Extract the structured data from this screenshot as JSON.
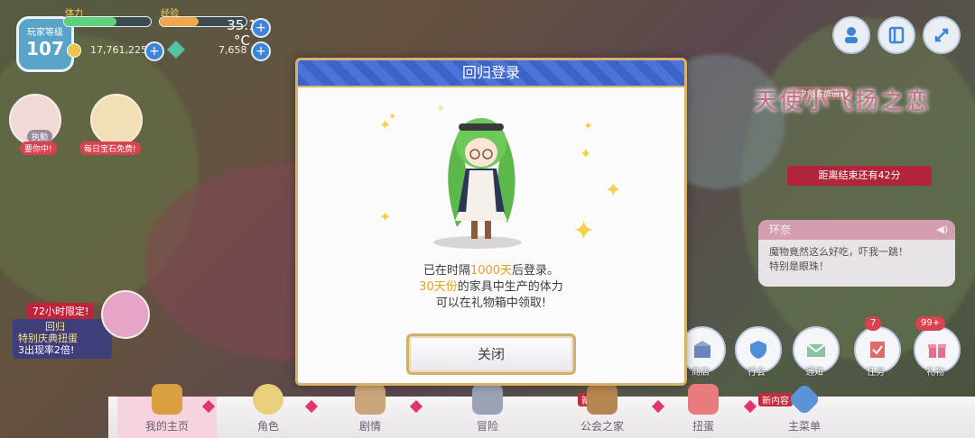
{
  "player": {
    "level_label": "玩家等级",
    "level": "107",
    "stamina_label": "体力",
    "exp_label": "经验",
    "stamina_fill": 0.6,
    "exp_fill": 0.45,
    "temperature": "35.1 °C",
    "mana": "17,761,225",
    "jewels": "7,658"
  },
  "top_buttons": [
    "person-icon",
    "window-icon",
    "resize-icon"
  ],
  "left_chars": [
    {
      "tag": "执勤"
    },
    {
      "tag": "要你中!"
    },
    {
      "tag": "每日宝石免费!"
    }
  ],
  "event": {
    "subtitle": "七夕剑客旅情谭",
    "title": "天使小飞扬之恋",
    "remaining": "距离结束还有42分"
  },
  "chat": {
    "speaker": "环奈",
    "line1": "魔物竟然这么好吃，吓我一跳！",
    "line2": "特别是眼珠！"
  },
  "promo": {
    "head": "72小时限定!",
    "line1": "回归",
    "line2": "特别庆典扭蛋",
    "line3": "3出现率2倍!"
  },
  "functions": [
    {
      "label": "商店"
    },
    {
      "label": "行会"
    },
    {
      "label": "通知"
    },
    {
      "label": "任务",
      "badge": "7"
    },
    {
      "label": "礼物",
      "badge": "99+"
    }
  ],
  "nav": [
    {
      "label": "我的主页"
    },
    {
      "label": "角色"
    },
    {
      "label": "剧情"
    },
    {
      "label": "冒险"
    },
    {
      "label": "公会之家"
    },
    {
      "label": "扭蛋"
    },
    {
      "label": "主菜单"
    }
  ],
  "new_tag": "新内容",
  "modal": {
    "title": "回归登录",
    "msg1_pre": "已在时隔",
    "msg1_hl": "1000天",
    "msg1_post": "后登录。",
    "msg2_hl": "30天份",
    "msg2_post": "的家具中生产的体力",
    "msg3": "可以在礼物箱中领取!",
    "close": "关闭"
  },
  "colors": {
    "modal_header": "#3c63c9",
    "highlight": "#e3a21a",
    "badge": "#d8434f"
  }
}
